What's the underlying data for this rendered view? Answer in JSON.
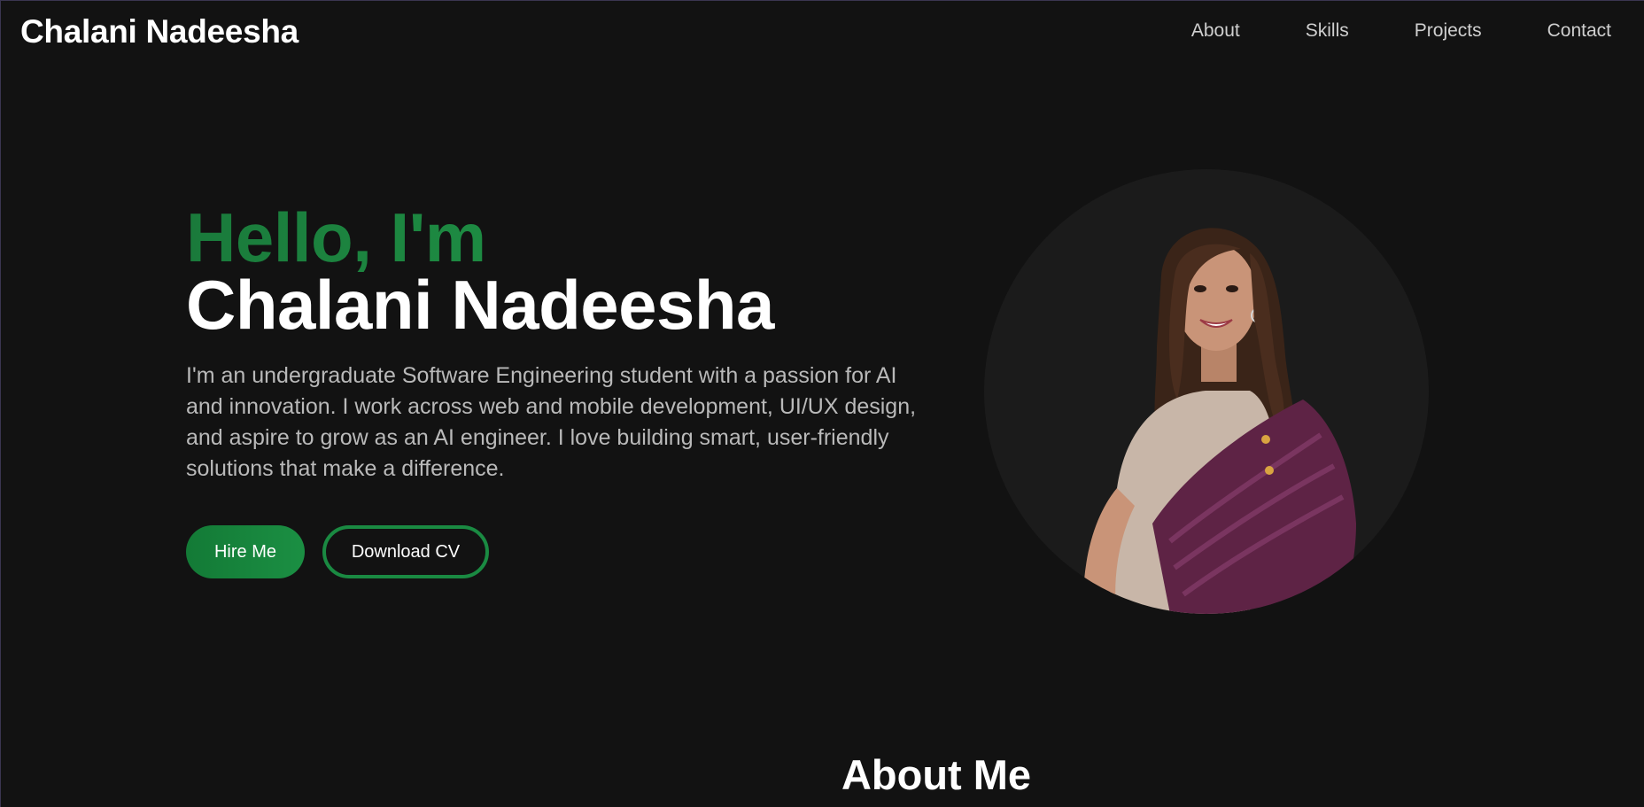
{
  "header": {
    "brand": "Chalani Nadeesha",
    "nav": [
      {
        "label": "About"
      },
      {
        "label": "Skills"
      },
      {
        "label": "Projects"
      },
      {
        "label": "Contact"
      }
    ]
  },
  "hero": {
    "greeting": "Hello, I'm",
    "name": "Chalani Nadeesha",
    "description": "I'm an undergraduate Software Engineering student with a passion for AI and innovation. I work across web and mobile development, UI/UX design, and aspire to grow as an AI engineer. I love building smart, user-friendly solutions that make a difference.",
    "buttons": {
      "hire": "Hire Me",
      "download": "Download CV"
    },
    "profile_image": "profile-photo"
  },
  "about": {
    "heading": "About Me"
  },
  "colors": {
    "background": "#121212",
    "accent": "#1a8a42",
    "text_muted": "#b9b9b9"
  }
}
